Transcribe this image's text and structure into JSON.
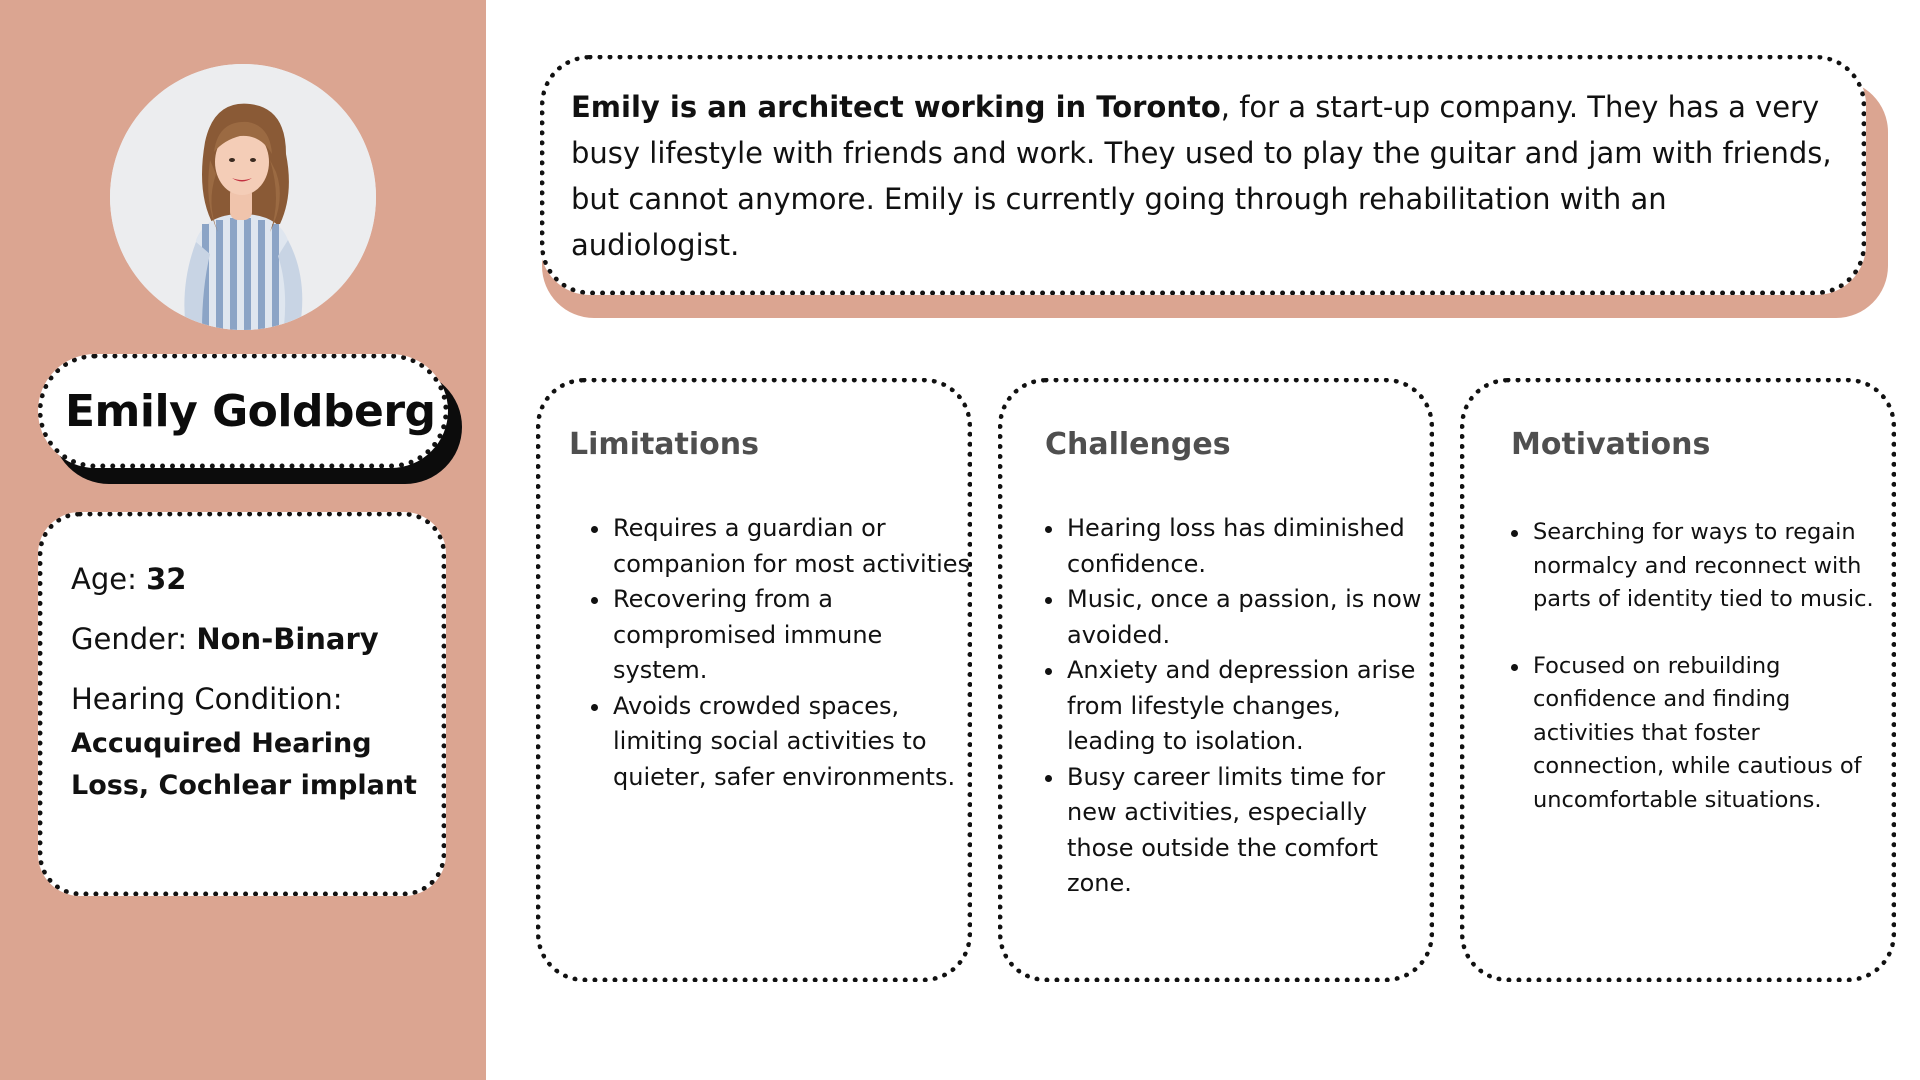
{
  "colors": {
    "accent": "#dba591",
    "card_background": "#ffffff",
    "border": "#111111",
    "heading_gray": "#4f4f4f"
  },
  "profile": {
    "photo_icon": "person-photo-icon",
    "name": "Emily Goldberg",
    "age_label": "Age:",
    "age_value": "32",
    "gender_label": "Gender:",
    "gender_value": "Non-Binary",
    "hearing_label": "Hearing Condition:",
    "hearing_value": "Accuquired Hearing Loss, Cochlear implant"
  },
  "bio": {
    "lead": "Emily is an architect working in Toronto",
    "rest": ", for a start-up company. They has a very busy lifestyle with friends and work. They used to play the guitar and jam with friends, but cannot anymore. Emily is currently going through rehabilitation with an audiologist."
  },
  "limitations": {
    "title": "Limitations",
    "items": [
      "Requires a guardian or companion for most activities",
      "Recovering from a compromised immune system.",
      "Avoids crowded spaces, limiting social activities to quieter, safer environments."
    ]
  },
  "challenges": {
    "title": "Challenges",
    "items": [
      "Hearing loss has diminished confidence.",
      "Music, once a passion, is now avoided.",
      "Anxiety and depression arise from lifestyle changes, leading to isolation.",
      "Busy career limits time for new activities, especially those outside the comfort zone."
    ]
  },
  "motivations": {
    "title": "Motivations",
    "items": [
      "Searching for ways to regain normalcy and reconnect with parts of identity tied to music.",
      "Focused on rebuilding confidence and finding activities that foster connection, while cautious of uncomfortable situations."
    ]
  }
}
